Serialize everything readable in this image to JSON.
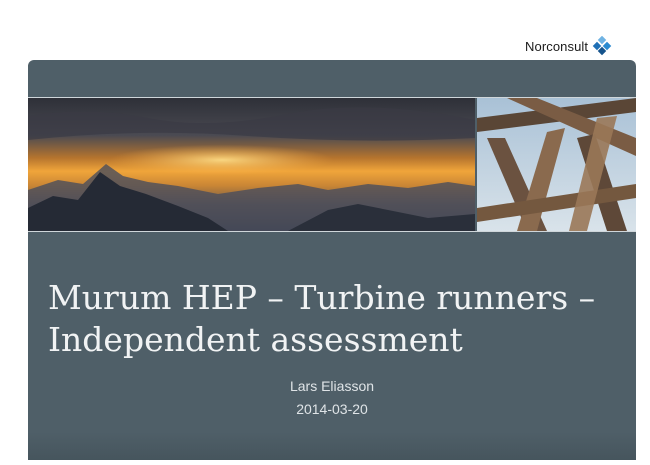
{
  "header": {
    "logo_text": "Norconsult",
    "logo_icon": "norconsult-diamond-logo"
  },
  "slide": {
    "title": "Murum HEP – Turbine runners – Independent assessment",
    "author": "Lars Eliasson",
    "date": "2014-03-20",
    "images": [
      "mountain-sunset-photo",
      "timber-truss-photo"
    ]
  },
  "colors": {
    "slide_background": "#4f5f68",
    "title_text": "#f1f3f4",
    "logo_blue": "#2a7fc1"
  }
}
